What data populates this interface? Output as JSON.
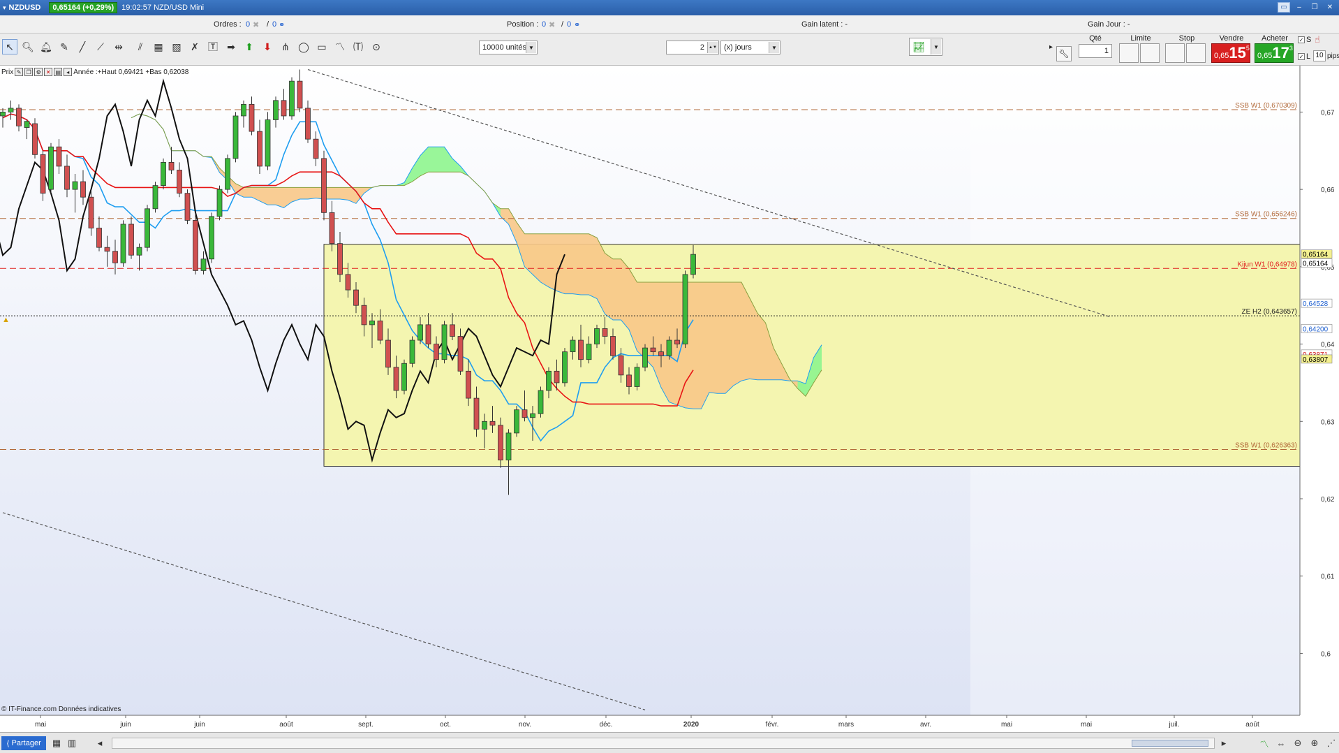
{
  "window": {
    "symbol": "NZDUSD",
    "price_badge": "0,65164 (+0,29%)",
    "time_title": "19:02:57 NZD/USD Mini"
  },
  "infobar": {
    "orders_label": "Ordres :",
    "orders_a": "0",
    "orders_b": "0",
    "position_label": "Position :",
    "position_val": "0",
    "position_b": "0",
    "gain_latent": "Gain latent : -",
    "gain_jour": "Gain Jour : -"
  },
  "toolbar": {
    "units_select": "10000 unités",
    "period_value": "2",
    "period_unit": "(x) jours",
    "qty_label": "Qté",
    "qty_value": "1",
    "limit_label": "Limite",
    "stop_label": "Stop",
    "sell_label": "Vendre",
    "sell_prefix": "0,65",
    "sell_big": "15",
    "sell_sup": "5",
    "buy_label": "Acheter",
    "buy_prefix": "0,65",
    "buy_big": "17",
    "buy_sup": "3",
    "s_check": "S",
    "l_check": "L",
    "pips_value": "10",
    "pips_label": "pips"
  },
  "legend": {
    "prefix": "Prix",
    "text": "Année :+Haut 0,69421 +Bas 0,62038"
  },
  "copyright": "© IT-Finance.com Données indicatives",
  "bottom": {
    "share_label": "Partager"
  },
  "colors": {
    "ichimoku_green": "#8ef58e",
    "ichimoku_orange": "#f8c888",
    "zone_yellow": "#f4f5b0",
    "tenkan": "#1f9ef0",
    "kijun": "#e81515",
    "chikou": "#111111",
    "bull": "#3ab83a",
    "bear": "#d05050"
  },
  "chart_data": {
    "type": "candlestick",
    "y_axis": {
      "min": 0.592,
      "max": 0.676,
      "ticks": [
        {
          "label": "0,67",
          "value": 0.67
        },
        {
          "label": "0,66",
          "value": 0.66
        },
        {
          "label": "0,65",
          "value": 0.65
        },
        {
          "label": "0,64",
          "value": 0.64
        },
        {
          "label": "0,63",
          "value": 0.63
        },
        {
          "label": "0,62",
          "value": 0.62
        },
        {
          "label": "0,61",
          "value": 0.61
        },
        {
          "label": "0,6",
          "value": 0.6
        }
      ]
    },
    "x_axis": {
      "labels": [
        "mai",
        "juin",
        "juin",
        "août",
        "sept.",
        "oct.",
        "nov.",
        "déc.",
        "2020",
        "févr.",
        "mars",
        "avr.",
        "mai",
        "mai",
        "juil.",
        "août"
      ],
      "bold": [
        false,
        false,
        false,
        false,
        false,
        false,
        false,
        false,
        true,
        false,
        false,
        false,
        false,
        false,
        false,
        false
      ]
    },
    "price_tags": [
      {
        "label": "0,65164",
        "value": 0.65164,
        "bg": "#f4f090",
        "fg": "#000"
      },
      {
        "label": "0,65164",
        "value": 0.65164,
        "bg": "#ffffff",
        "fg": "#000",
        "offset": 1
      },
      {
        "label": "0,64528",
        "value": 0.64528,
        "bg": "#ffffff",
        "fg": "#1f60d0"
      },
      {
        "label": "0,64200",
        "value": 0.642,
        "bg": "#ffffff",
        "fg": "#1f60d0"
      },
      {
        "label": "0,63871",
        "value": 0.63871,
        "bg": "#ffffff",
        "fg": "#d01010"
      },
      {
        "label": "0,63807",
        "value": 0.63807,
        "bg": "#f4f090",
        "fg": "#000"
      }
    ],
    "levels": [
      {
        "label": "SSB W1 (0,670309)",
        "value": 0.670309,
        "color": "#b26a3a",
        "style": "dash"
      },
      {
        "label": "SSB W1 (0,656246)",
        "value": 0.656246,
        "color": "#b26a3a",
        "style": "dash"
      },
      {
        "label": "Kijun W1 (0,64978)",
        "value": 0.64978,
        "color": "#e02020",
        "style": "dash"
      },
      {
        "label": "ZE H2 (0,643657)",
        "value": 0.643657,
        "color": "#222222",
        "style": "dot"
      },
      {
        "label": "SSB W1 (0,626363)",
        "value": 0.626363,
        "color": "#b26a3a",
        "style": "dash"
      }
    ],
    "zone": {
      "from_index": 40,
      "to_index": 168,
      "top": 0.6529,
      "bottom": 0.6242
    },
    "trendlines": [
      {
        "from": [
          38,
          0.6755
        ],
        "to": [
          138,
          0.6435
        ]
      },
      {
        "from": [
          0,
          0.6182
        ],
        "to": [
          80,
          0.5927
        ]
      }
    ],
    "candles": [
      [
        0.6695,
        0.6705,
        0.668,
        0.67
      ],
      [
        0.67,
        0.6715,
        0.669,
        0.6705
      ],
      [
        0.6705,
        0.671,
        0.6675,
        0.6682
      ],
      [
        0.668,
        0.669,
        0.6665,
        0.6688
      ],
      [
        0.6685,
        0.6692,
        0.664,
        0.6645
      ],
      [
        0.6645,
        0.665,
        0.6585,
        0.6595
      ],
      [
        0.66,
        0.666,
        0.6595,
        0.6655
      ],
      [
        0.6655,
        0.6665,
        0.662,
        0.663
      ],
      [
        0.663,
        0.6645,
        0.659,
        0.66
      ],
      [
        0.66,
        0.662,
        0.657,
        0.661
      ],
      [
        0.661,
        0.6625,
        0.658,
        0.659
      ],
      [
        0.659,
        0.66,
        0.654,
        0.655
      ],
      [
        0.655,
        0.6565,
        0.652,
        0.6525
      ],
      [
        0.6525,
        0.654,
        0.65,
        0.652
      ],
      [
        0.652,
        0.6535,
        0.649,
        0.6505
      ],
      [
        0.6505,
        0.656,
        0.65,
        0.6555
      ],
      [
        0.6555,
        0.6565,
        0.651,
        0.6515
      ],
      [
        0.6515,
        0.653,
        0.6495,
        0.6525
      ],
      [
        0.6525,
        0.658,
        0.652,
        0.6575
      ],
      [
        0.6575,
        0.661,
        0.657,
        0.6605
      ],
      [
        0.6605,
        0.664,
        0.66,
        0.6635
      ],
      [
        0.6635,
        0.6655,
        0.662,
        0.6625
      ],
      [
        0.6625,
        0.6635,
        0.659,
        0.6595
      ],
      [
        0.6595,
        0.66,
        0.6555,
        0.656
      ],
      [
        0.656,
        0.657,
        0.649,
        0.6495
      ],
      [
        0.6495,
        0.652,
        0.649,
        0.651
      ],
      [
        0.651,
        0.657,
        0.6505,
        0.6565
      ],
      [
        0.6565,
        0.6605,
        0.656,
        0.66
      ],
      [
        0.66,
        0.6645,
        0.6595,
        0.664
      ],
      [
        0.664,
        0.67,
        0.6635,
        0.6695
      ],
      [
        0.6695,
        0.6715,
        0.668,
        0.671
      ],
      [
        0.671,
        0.672,
        0.667,
        0.6675
      ],
      [
        0.6675,
        0.669,
        0.662,
        0.663
      ],
      [
        0.663,
        0.67,
        0.6625,
        0.669
      ],
      [
        0.669,
        0.672,
        0.668,
        0.6715
      ],
      [
        0.6715,
        0.673,
        0.669,
        0.6695
      ],
      [
        0.6695,
        0.6745,
        0.669,
        0.674
      ],
      [
        0.674,
        0.6755,
        0.67,
        0.6705
      ],
      [
        0.6705,
        0.6715,
        0.666,
        0.6665
      ],
      [
        0.6665,
        0.6675,
        0.663,
        0.664
      ],
      [
        0.664,
        0.665,
        0.656,
        0.657
      ],
      [
        0.657,
        0.6585,
        0.652,
        0.653
      ],
      [
        0.653,
        0.6545,
        0.648,
        0.649
      ],
      [
        0.649,
        0.6505,
        0.646,
        0.647
      ],
      [
        0.647,
        0.648,
        0.644,
        0.645
      ],
      [
        0.645,
        0.646,
        0.641,
        0.6425
      ],
      [
        0.6425,
        0.644,
        0.6395,
        0.643
      ],
      [
        0.643,
        0.6445,
        0.64,
        0.6405
      ],
      [
        0.6405,
        0.642,
        0.636,
        0.637
      ],
      [
        0.637,
        0.6385,
        0.633,
        0.634
      ],
      [
        0.634,
        0.638,
        0.6335,
        0.6375
      ],
      [
        0.6375,
        0.641,
        0.637,
        0.6405
      ],
      [
        0.6405,
        0.6435,
        0.64,
        0.6425
      ],
      [
        0.6425,
        0.644,
        0.6395,
        0.64
      ],
      [
        0.64,
        0.641,
        0.637,
        0.638
      ],
      [
        0.638,
        0.643,
        0.6375,
        0.6425
      ],
      [
        0.6425,
        0.644,
        0.6405,
        0.641
      ],
      [
        0.641,
        0.642,
        0.636,
        0.6365
      ],
      [
        0.6365,
        0.638,
        0.632,
        0.633
      ],
      [
        0.633,
        0.6345,
        0.628,
        0.629
      ],
      [
        0.629,
        0.631,
        0.6265,
        0.63
      ],
      [
        0.63,
        0.632,
        0.6285,
        0.6295
      ],
      [
        0.6295,
        0.6305,
        0.624,
        0.625
      ],
      [
        0.625,
        0.629,
        0.6205,
        0.6285
      ],
      [
        0.6285,
        0.632,
        0.628,
        0.6315
      ],
      [
        0.6315,
        0.634,
        0.63,
        0.6305
      ],
      [
        0.6305,
        0.632,
        0.6275,
        0.631
      ],
      [
        0.631,
        0.6345,
        0.6305,
        0.634
      ],
      [
        0.634,
        0.637,
        0.633,
        0.6365
      ],
      [
        0.6365,
        0.638,
        0.634,
        0.635
      ],
      [
        0.635,
        0.6395,
        0.6345,
        0.639
      ],
      [
        0.639,
        0.641,
        0.638,
        0.6405
      ],
      [
        0.6405,
        0.6425,
        0.637,
        0.638
      ],
      [
        0.638,
        0.641,
        0.6375,
        0.64
      ],
      [
        0.64,
        0.6425,
        0.6395,
        0.642
      ],
      [
        0.642,
        0.6435,
        0.64,
        0.641
      ],
      [
        0.641,
        0.642,
        0.638,
        0.6385
      ],
      [
        0.6385,
        0.6395,
        0.635,
        0.636
      ],
      [
        0.636,
        0.637,
        0.6335,
        0.6345
      ],
      [
        0.6345,
        0.6375,
        0.634,
        0.637
      ],
      [
        0.637,
        0.64,
        0.6365,
        0.6395
      ],
      [
        0.6395,
        0.641,
        0.6385,
        0.639
      ],
      [
        0.639,
        0.64,
        0.637,
        0.6385
      ],
      [
        0.6385,
        0.641,
        0.638,
        0.6405
      ],
      [
        0.6405,
        0.642,
        0.6395,
        0.64
      ],
      [
        0.64,
        0.6495,
        0.6395,
        0.649
      ],
      [
        0.649,
        0.6528,
        0.6485,
        0.6516
      ]
    ],
    "candle_x_start": 0,
    "candle_x_step": 1
  }
}
